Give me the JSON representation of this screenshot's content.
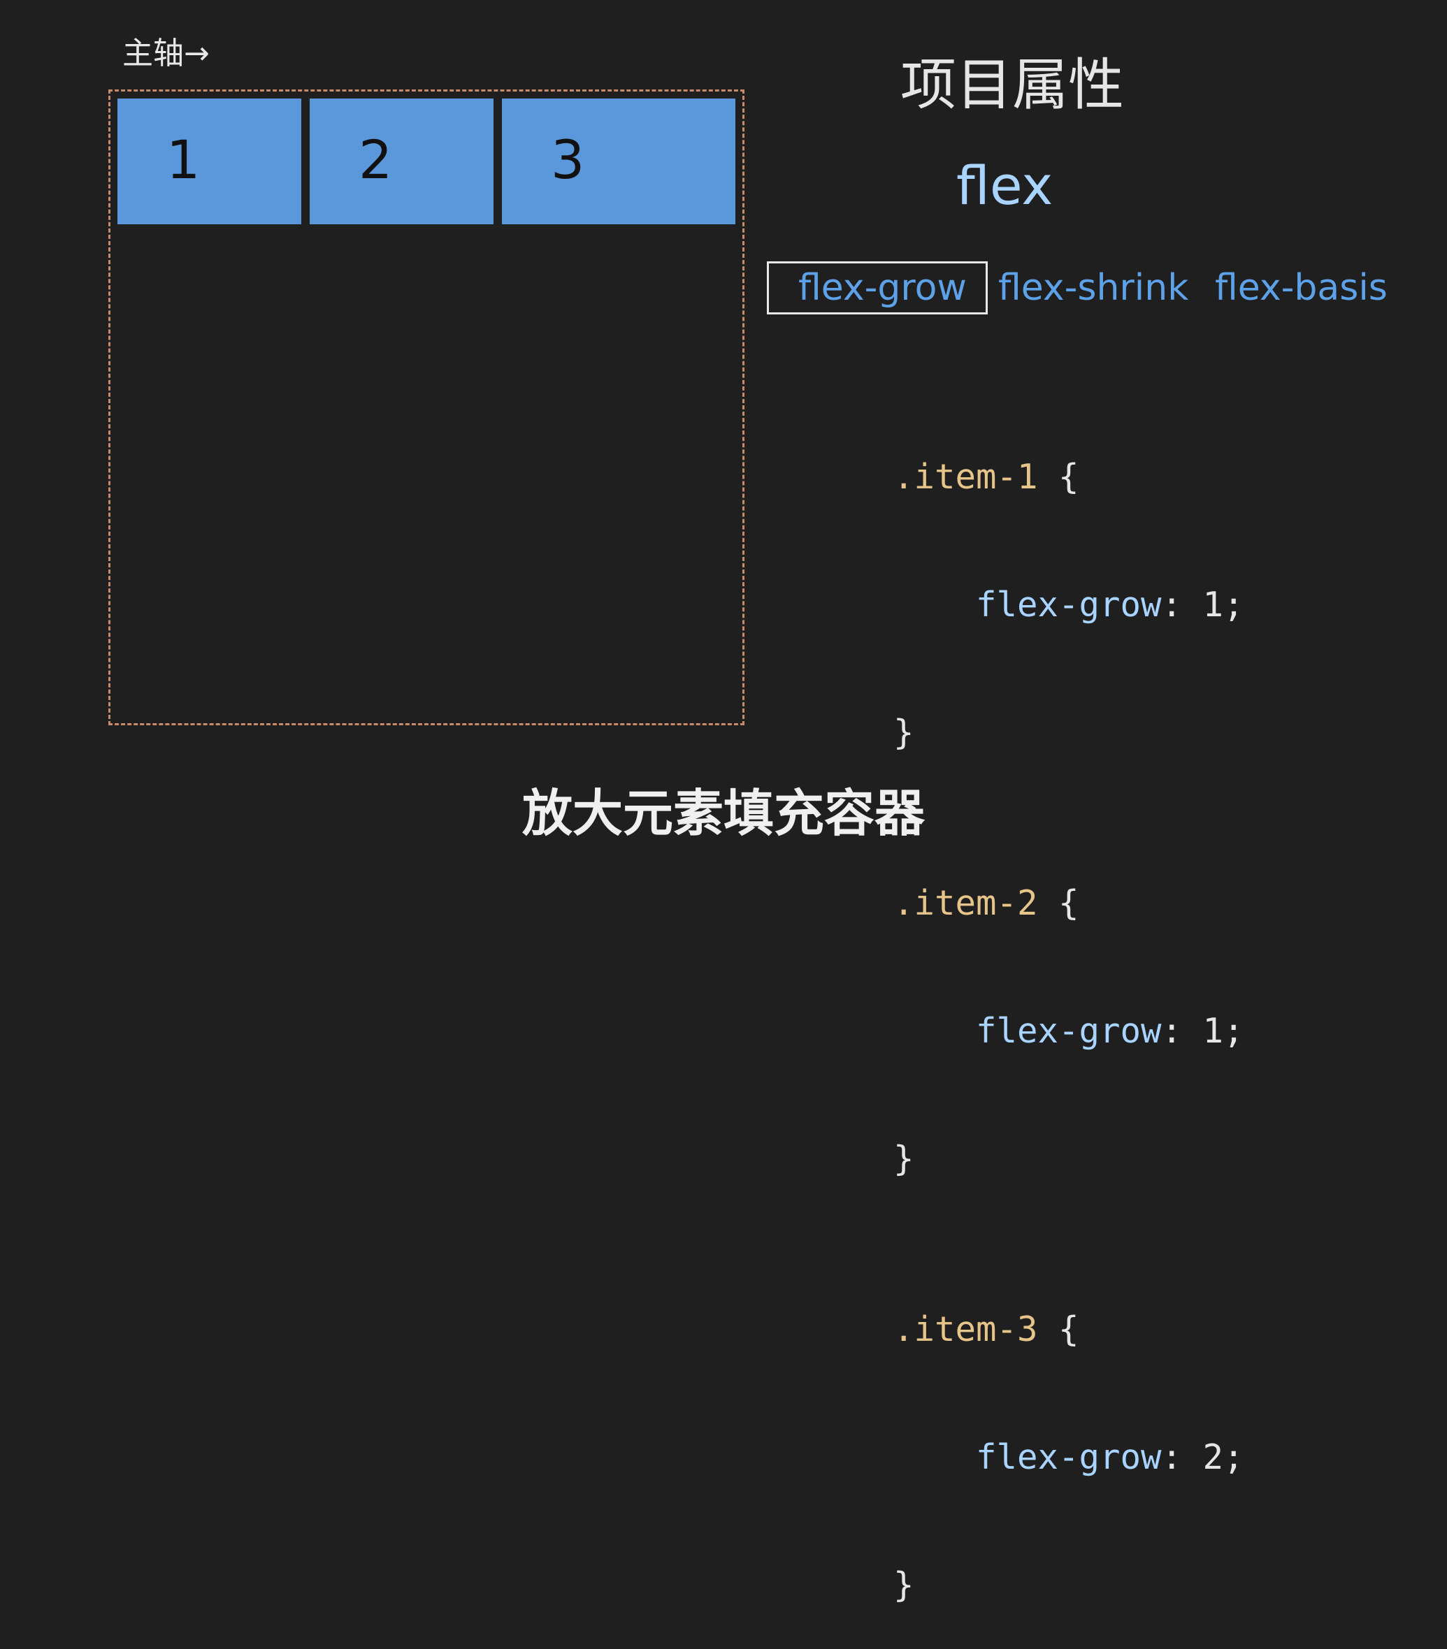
{
  "diagram": {
    "axis_label": "主轴→",
    "items": [
      "1",
      "2",
      "3"
    ]
  },
  "header": {
    "title": "项目属性",
    "subtitle": "flex"
  },
  "tabs": [
    {
      "label": "flex-grow",
      "selected": true
    },
    {
      "label": "flex-shrink",
      "selected": false
    },
    {
      "label": "flex-basis",
      "selected": false
    }
  ],
  "code": [
    {
      "selector": ".item-1",
      "open": " {",
      "property": "flex-grow",
      "value": ": 1;",
      "close": "}"
    },
    {
      "selector": ".item-2",
      "open": " {",
      "property": "flex-grow",
      "value": ": 1;",
      "close": "}"
    },
    {
      "selector": ".item-3",
      "open": " {",
      "property": "flex-grow",
      "value": ": 2;",
      "close": "}"
    }
  ],
  "caption": "放大元素填充容器",
  "colors": {
    "background": "#1f1f1f",
    "item_fill": "#5b98db",
    "container_border": "#c98a6a",
    "selector": "#e6c48a",
    "property": "#a9d4ff",
    "tab_text": "#5da2e8"
  }
}
